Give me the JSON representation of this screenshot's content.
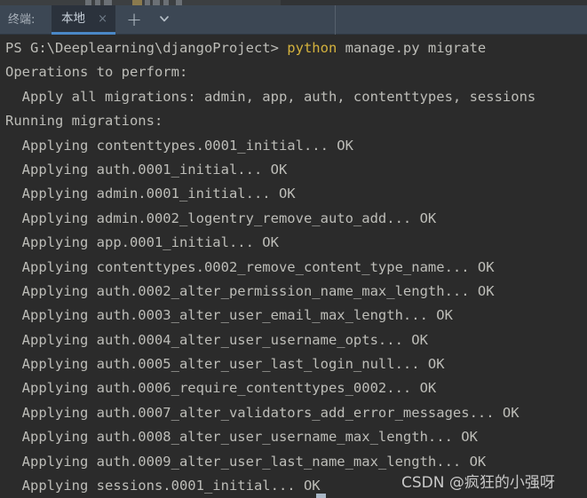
{
  "window": {
    "panel_label": "终端:"
  },
  "tab_bar": {
    "tabs": [
      {
        "label": "本地",
        "close_icon": "×",
        "active": true
      }
    ],
    "new_tab_icon": "+",
    "tab_menu_icon": "chevron-down-icon"
  },
  "terminal": {
    "prompt_line": {
      "prompt": "PS G:\\Deeplearning\\djangoProject> ",
      "keyword": "python",
      "args": " manage.py migrate"
    },
    "lines": [
      "Operations to perform:",
      "  Apply all migrations: admin, app, auth, contenttypes, sessions",
      "Running migrations:",
      "  Applying contenttypes.0001_initial... OK",
      "  Applying auth.0001_initial... OK",
      "  Applying admin.0001_initial... OK",
      "  Applying admin.0002_logentry_remove_auto_add... OK",
      "  Applying app.0001_initial... OK",
      "  Applying contenttypes.0002_remove_content_type_name... OK",
      "  Applying auth.0002_alter_permission_name_max_length... OK",
      "  Applying auth.0003_alter_user_email_max_length... OK",
      "  Applying auth.0004_alter_user_username_opts... OK",
      "  Applying auth.0005_alter_user_last_login_null... OK",
      "  Applying auth.0006_require_contenttypes_0002... OK",
      "  Applying auth.0007_alter_validators_add_error_messages... OK",
      "  Applying auth.0008_alter_user_username_max_length... OK",
      "  Applying auth.0009_alter_user_last_name_max_length... OK",
      "  Applying sessions.0001_initial... OK"
    ]
  },
  "watermark": {
    "text": "CSDN @疯狂的小强呀"
  },
  "colors": {
    "terminal_background": "#2b2b2b",
    "terminal_foreground": "#bdbdb8",
    "keyword_yellow": "#d4b23d",
    "tab_bar_background": "#3c4754",
    "active_tab_background": "#2b323c",
    "active_tab_underline": "#4a88c7"
  }
}
